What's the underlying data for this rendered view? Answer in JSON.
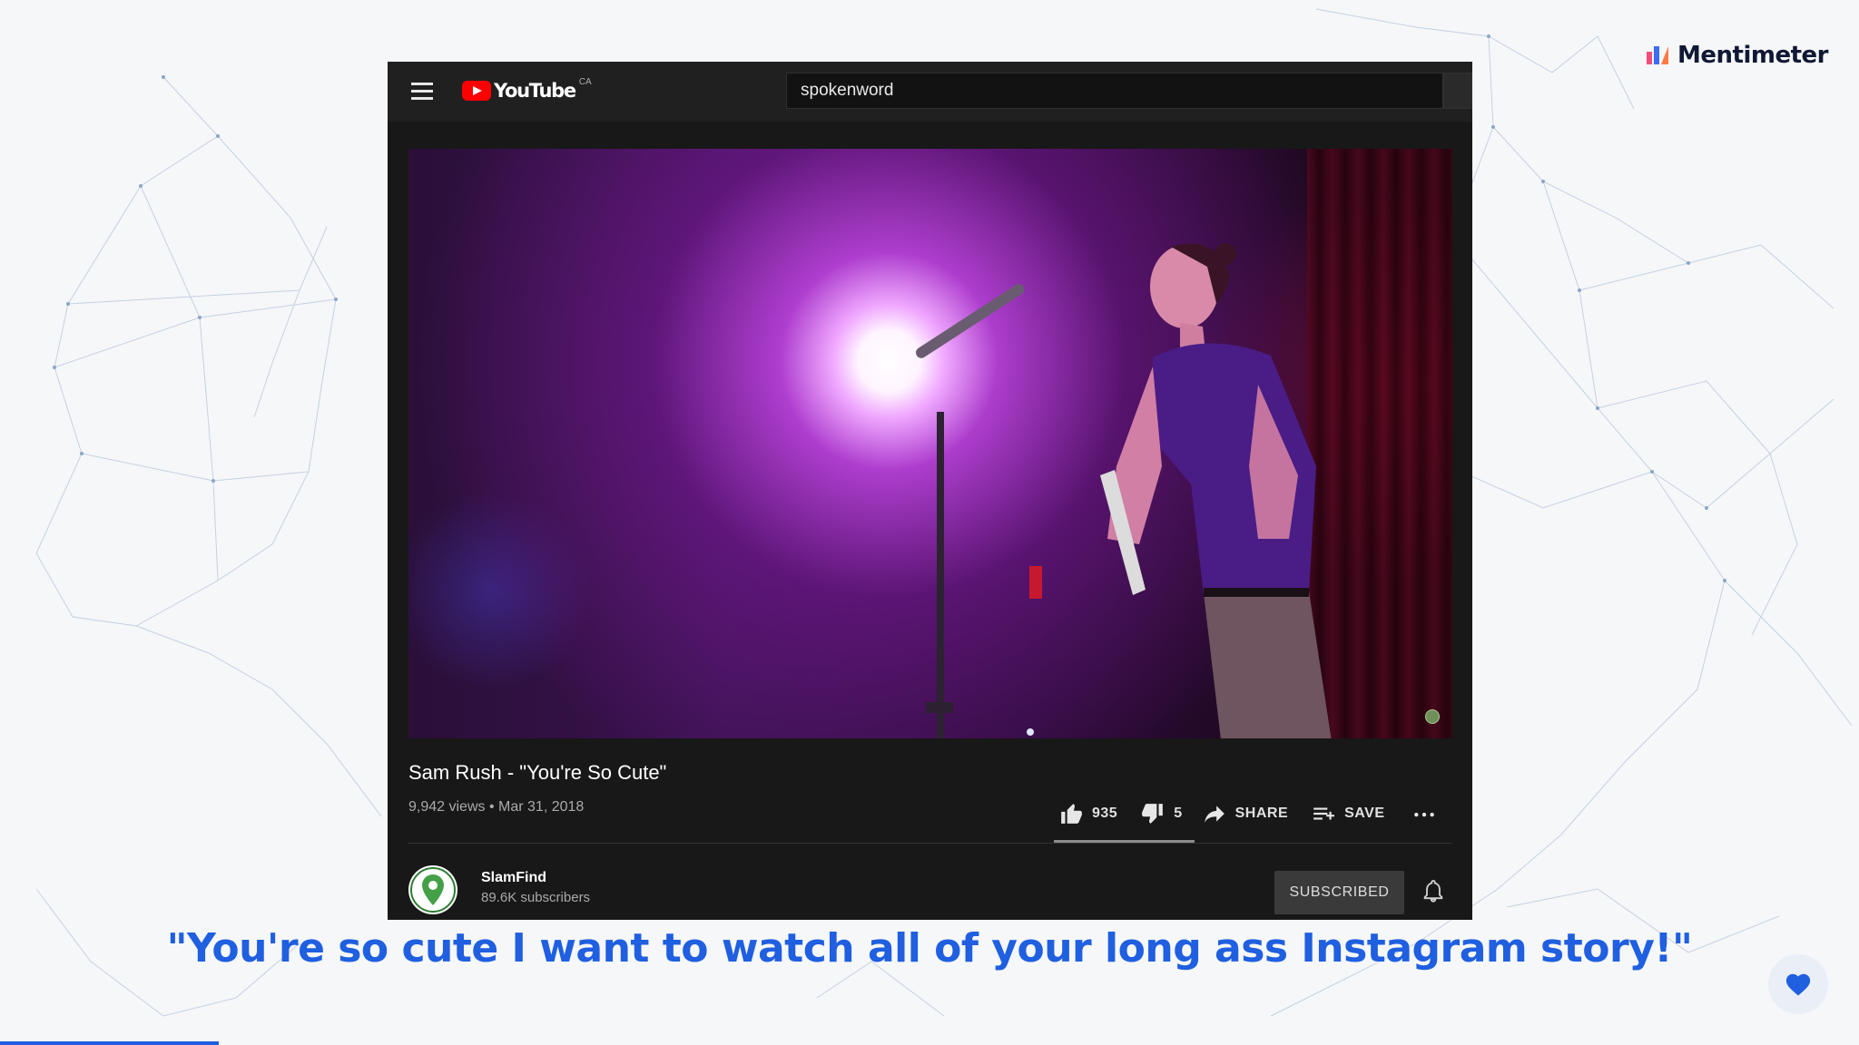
{
  "branding": {
    "name": "Mentimeter"
  },
  "youtube": {
    "logo_text": "YouTube",
    "region": "CA",
    "search_value": "spokenword",
    "video": {
      "title": "Sam Rush - \"You're So Cute\"",
      "views": "9,942 views",
      "separator": "•",
      "date": "Mar 31, 2018"
    },
    "actions": {
      "likes": "935",
      "dislikes": "5",
      "share": "SHARE",
      "save": "SAVE"
    },
    "channel": {
      "name": "SlamFind",
      "subscribers": "89.6K subscribers",
      "subscribe_state": "SUBSCRIBED"
    }
  },
  "quote": "\"You're so cute I want to watch all of your long ass Instagram story!\"",
  "colors": {
    "accent": "#1f5fe0",
    "youtube_red": "#ff0000",
    "player_bg": "#181818"
  },
  "icons": [
    "hamburger-menu-icon",
    "youtube-play-icon",
    "thumbs-up-icon",
    "thumbs-down-icon",
    "share-arrow-icon",
    "playlist-add-icon",
    "more-horizontal-icon",
    "bell-icon",
    "heart-icon"
  ]
}
